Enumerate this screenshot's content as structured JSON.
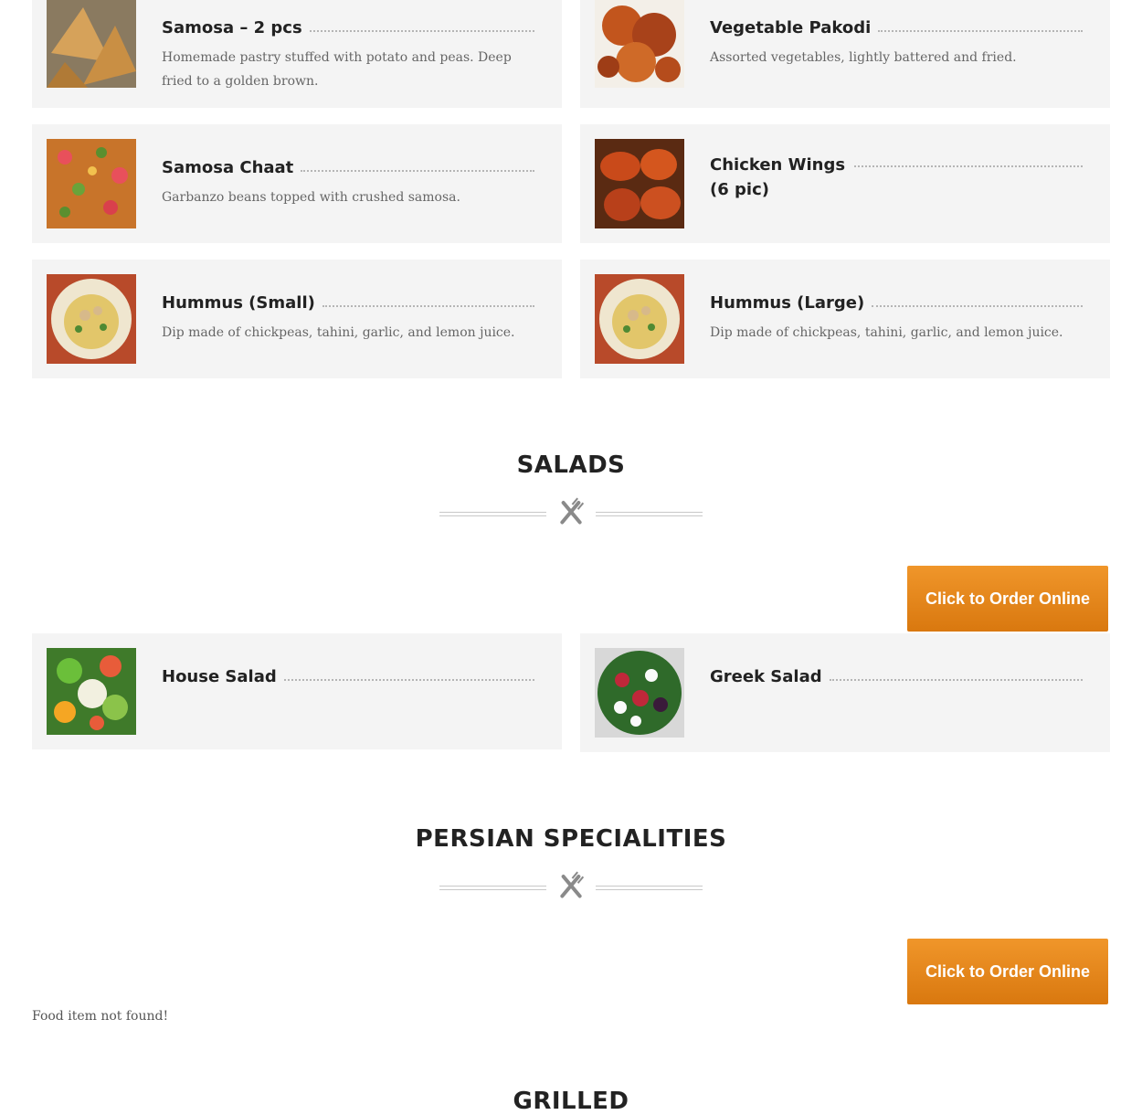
{
  "appetizers": [
    {
      "name": "Samosa – 2 pcs",
      "desc": "Homemade pastry stuffed with potato and peas. Deep fried to a golden brown.",
      "image": "samosa-image"
    },
    {
      "name": "Vegetable Pakodi",
      "desc": "Assorted vegetables, lightly battered and fried.",
      "image": "pakodi-image"
    },
    {
      "name": "Samosa Chaat",
      "desc": "Garbanzo beans topped with crushed samosa.",
      "image": "samosa-chaat-image"
    },
    {
      "name": "Chicken Wings (6 pic)",
      "desc": "",
      "image": "chicken-wings-image"
    },
    {
      "name": "Hummus (Small)",
      "desc": "Dip made of chickpeas, tahini, garlic, and lemon juice.",
      "image": "hummus-image"
    },
    {
      "name": "Hummus (Large)",
      "desc": "Dip made of chickpeas, tahini, garlic, and lemon juice.",
      "image": "hummus-image"
    }
  ],
  "salads": {
    "title": "SALADS",
    "order_label": "Click to Order Online",
    "items": [
      {
        "name": "House Salad",
        "desc": "",
        "image": "house-salad-image"
      },
      {
        "name": "Greek Salad",
        "desc": "",
        "image": "greek-salad-image"
      }
    ]
  },
  "persian": {
    "title": "PERSIAN SPECIALITIES",
    "order_label": "Click to Order Online",
    "not_found": "Food item not found!"
  },
  "grilled": {
    "title": "GRILLED"
  },
  "icons": {
    "divider": "fork-knife-icon"
  },
  "colors": {
    "button": "#e68620",
    "card": "#f4f4f4"
  }
}
